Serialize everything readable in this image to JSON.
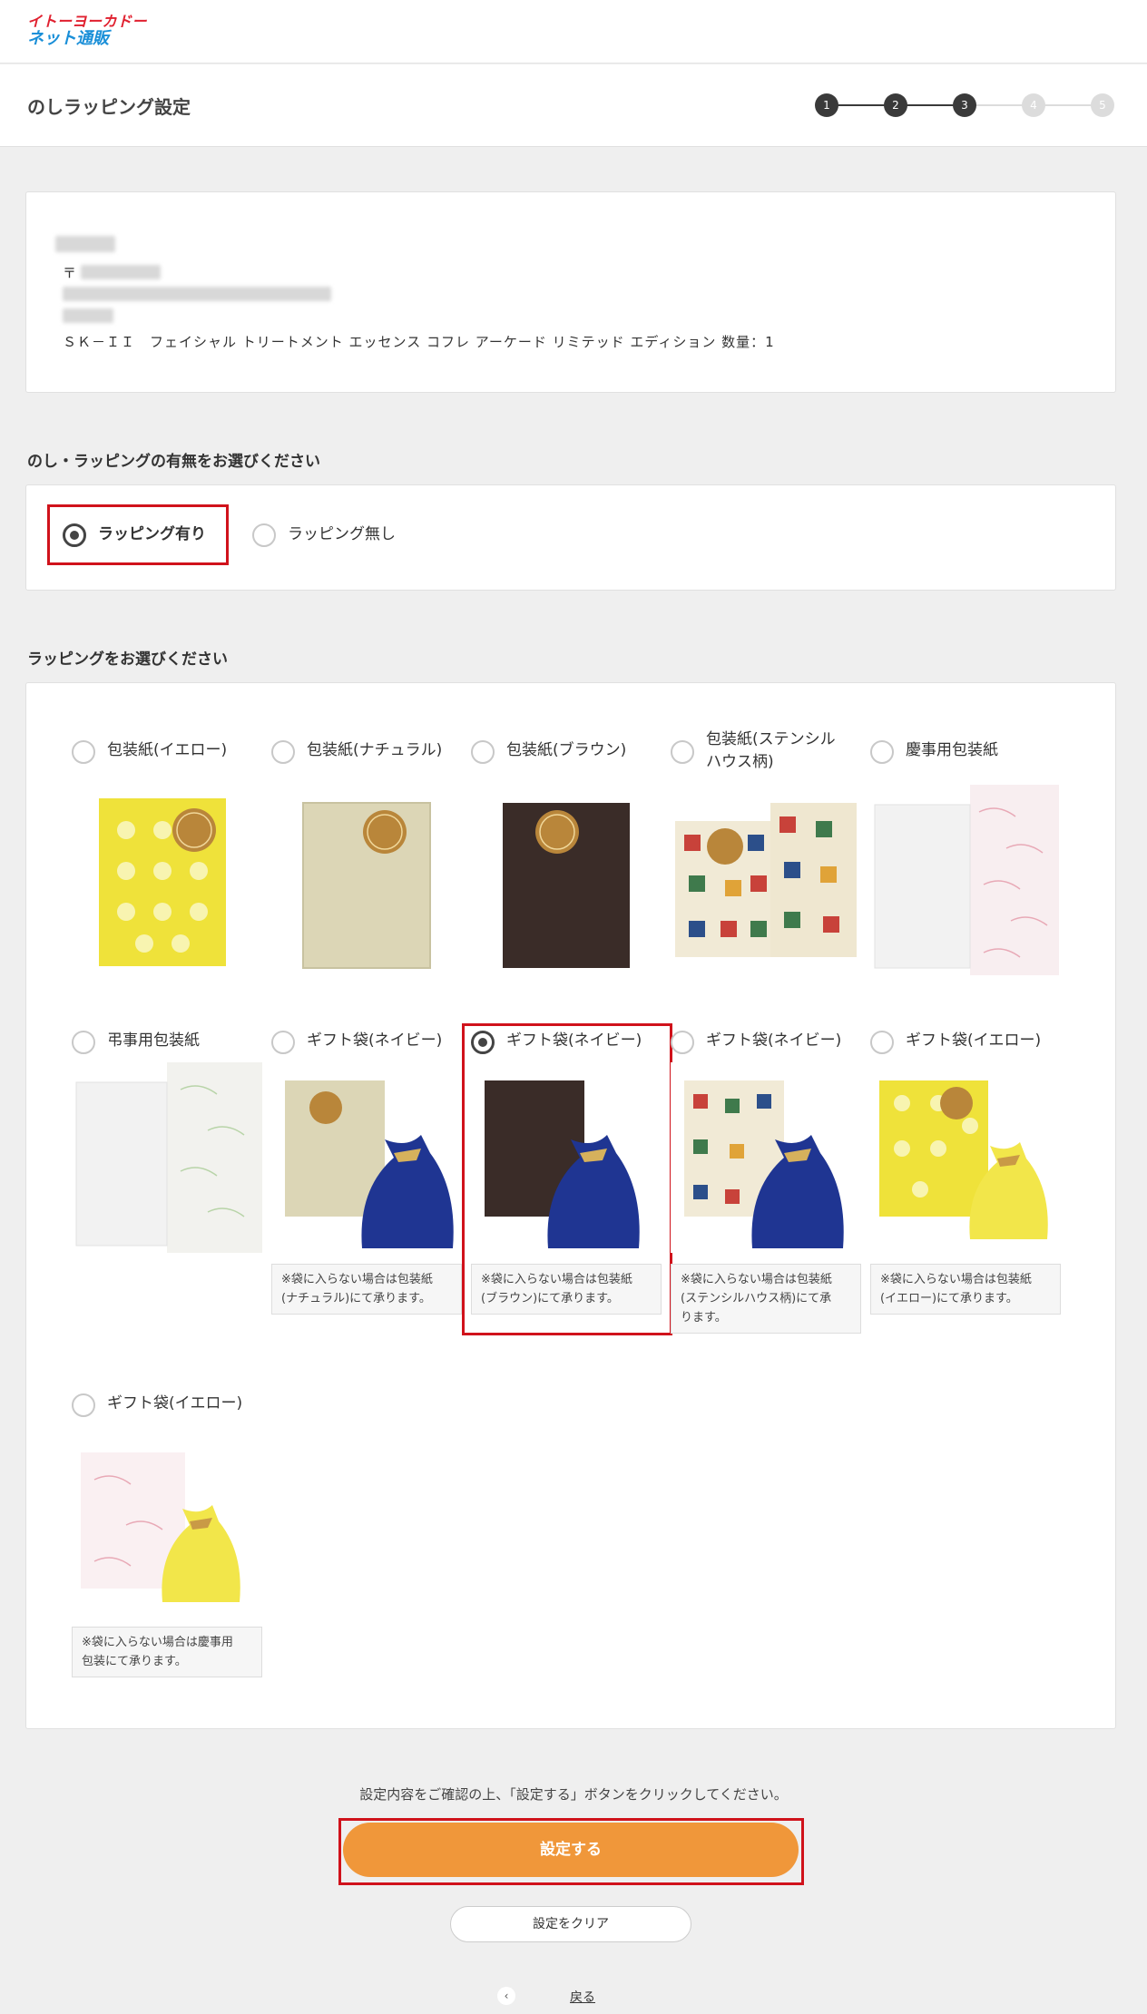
{
  "header": {
    "logo_line1": "イトーヨーカドー",
    "logo_line2": "ネット通販"
  },
  "titlebar": {
    "title": "のしラッピング設定"
  },
  "steps": [
    {
      "label": "1",
      "state": "done"
    },
    {
      "label": "2",
      "state": "done"
    },
    {
      "label": "3",
      "state": "current"
    },
    {
      "label": "4",
      "state": "todo"
    },
    {
      "label": "5",
      "state": "todo"
    }
  ],
  "address_card": {
    "postal_mark": "〒",
    "product": "ＳＫ－ＩＩ　フェイシャル トリートメント エッセンス コフレ アーケード リミテッド エディション 数量：1"
  },
  "wrap_section": {
    "heading": "のし・ラッピングの有無をお選びください",
    "options": [
      {
        "label": "ラッピング有り",
        "selected": true
      },
      {
        "label": "ラッピング無し",
        "selected": false
      }
    ]
  },
  "select_section": {
    "heading": "ラッピングをお選びください",
    "items": [
      {
        "label": "包装紙(イエロー)",
        "selected": false,
        "note": ""
      },
      {
        "label": "包装紙(ナチュラル)",
        "selected": false,
        "note": ""
      },
      {
        "label": "包装紙(ブラウン)",
        "selected": false,
        "note": ""
      },
      {
        "label": "包装紙(ステンシルハウス柄)",
        "label_line1": "包装紙(ステンシル",
        "label_line2": "ハウス柄)",
        "selected": false,
        "note": ""
      },
      {
        "label": "慶事用包装紙",
        "selected": false,
        "note": ""
      },
      {
        "label": "弔事用包装紙",
        "selected": false,
        "note": ""
      },
      {
        "label": "ギフト袋(ネイビー)",
        "selected": false,
        "note_line1": "※袋に入らない場合は包装紙",
        "note_line2": "(ナチュラル)にて承ります。"
      },
      {
        "label": "ギフト袋(ネイビー)",
        "selected": true,
        "note_line1": "※袋に入らない場合は包装紙",
        "note_line2": "(ブラウン)にて承ります。"
      },
      {
        "label": "ギフト袋(ネイビー)",
        "selected": false,
        "note_line1": "※袋に入らない場合は包装紙",
        "note_line2": "(ステンシルハウス柄)にて承",
        "note_line3": "ります。"
      },
      {
        "label": "ギフト袋(イエロー)",
        "selected": false,
        "note_line1": "※袋に入らない場合は包装紙",
        "note_line2": "(イエロー)にて承ります。"
      },
      {
        "label": "ギフト袋(イエロー)",
        "selected": false,
        "note_line1": "※袋に入らない場合は慶事用",
        "note_line2": "包装にて承ります。"
      }
    ]
  },
  "footer": {
    "instruction": "設定内容をご確認の上、「設定する」ボタンをクリックしてください。",
    "submit_label": "設定する",
    "clear_label": "設定をクリア",
    "back_label": "戻る",
    "back_icon": "‹"
  },
  "colors": {
    "accent": "#f0973a",
    "highlight": "#d0121b",
    "step_done": "#3a3a3a",
    "step_todo": "#dcdcdc"
  }
}
